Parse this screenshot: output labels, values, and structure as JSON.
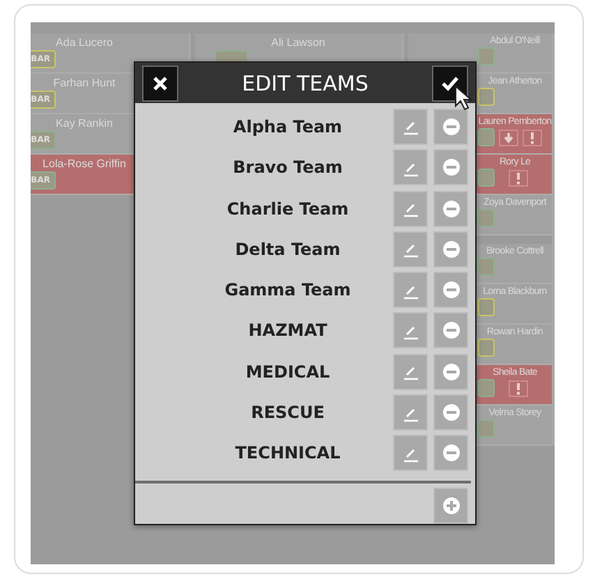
{
  "board": {
    "columns": [
      {
        "cards": [
          {
            "name": "Ada Lucero",
            "alert": false,
            "badge": "BAR",
            "color": "#c9c46a"
          },
          {
            "name": "Farhan Hunt",
            "alert": false,
            "badge": "BAR",
            "color": "#c9c46a"
          },
          {
            "name": "Kay Rankin",
            "alert": false,
            "badge": "BAR",
            "color": "#8fb08f"
          },
          {
            "name": "Lola-Rose Griffin",
            "alert": true,
            "badge": "BAR",
            "color": "#8fb08f"
          }
        ]
      },
      {
        "cards": [
          {
            "name": "Ali Lawson",
            "alert": false,
            "color": "#8fb08f"
          }
        ]
      },
      {
        "cards": [
          {
            "name": "Abdul O'Neill",
            "alert": false,
            "color": "#8fb08f"
          },
          {
            "name": "Jean Atherton",
            "alert": false,
            "color": "#c9c46a"
          },
          {
            "name": "Lauren Pemberton",
            "alert": true,
            "color": "#8fb08f",
            "down_flag": true,
            "alert_flag": true
          },
          {
            "name": "Rory Le",
            "alert": true,
            "color": "#8fb08f",
            "alert_flag": true
          },
          {
            "name": "Zoya Davenport",
            "alert": false,
            "color": "#8fb08f"
          },
          {
            "kind": "gap"
          },
          {
            "name": "Brooke Cottrell",
            "alert": false,
            "color": "#8fb08f"
          },
          {
            "name": "Lorna Blackburn",
            "alert": false,
            "color": "#c9c46a"
          },
          {
            "name": "Rowan Hardin",
            "alert": false,
            "color": "#c9c46a"
          },
          {
            "name": "Sheila Bate",
            "alert": true,
            "color": "#8fb08f",
            "alert_flag": true
          },
          {
            "name": "Velma Storey",
            "alert": false,
            "color": "#8fb08f"
          }
        ]
      }
    ]
  },
  "dialog": {
    "title": "EDIT TEAMS",
    "teams": [
      {
        "name": "Alpha Team"
      },
      {
        "name": "Bravo Team"
      },
      {
        "name": "Charlie Team"
      },
      {
        "name": "Delta Team"
      },
      {
        "name": "Gamma Team"
      },
      {
        "name": "HAZMAT"
      },
      {
        "name": "MEDICAL"
      },
      {
        "name": "RESCUE"
      },
      {
        "name": "TECHNICAL"
      }
    ]
  }
}
